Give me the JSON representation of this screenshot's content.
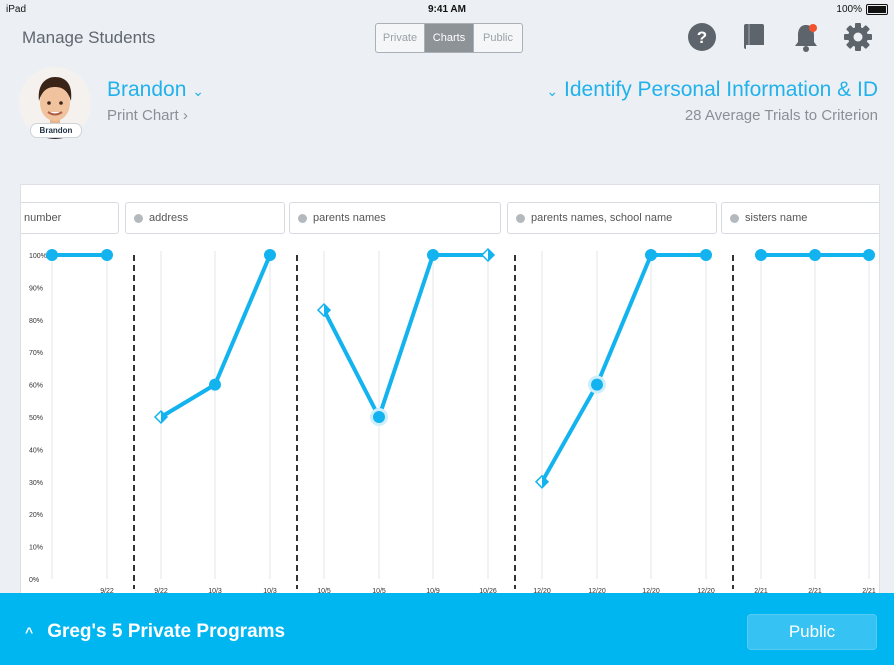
{
  "status_bar": {
    "device": "iPad",
    "time": "9:41 AM",
    "battery": "100%"
  },
  "header": {
    "title": "Manage Students",
    "segments": [
      {
        "label": "Private",
        "active": false
      },
      {
        "label": "Charts",
        "active": true
      },
      {
        "label": "Public",
        "active": false
      }
    ],
    "icons": [
      "help-icon",
      "book-icon",
      "bell-icon",
      "gear-icon"
    ]
  },
  "student": {
    "name": "Brandon",
    "avatar_label": "Brandon",
    "print_chart": "Print Chart ›"
  },
  "program": {
    "name": "Identify Personal Information & ID",
    "subtitle": "28 Average Trials to Criterion"
  },
  "chart_data": {
    "type": "line",
    "ylim": [
      0,
      100
    ],
    "y_ticks": [
      "0%",
      "10%",
      "20%",
      "30%",
      "40%",
      "50%",
      "60%",
      "70%",
      "80%",
      "90%",
      "100%"
    ],
    "accent_color": "#13b3ef",
    "phases": [
      {
        "label": "number",
        "dates": [
          "",
          "9/22"
        ],
        "values": [
          100,
          100
        ],
        "markers": [
          "dot",
          "dot"
        ]
      },
      {
        "label": "address",
        "dates": [
          "9/22",
          "10/3",
          "10/3"
        ],
        "values": [
          50,
          60,
          100
        ],
        "markers": [
          "half",
          "dot",
          "dot"
        ]
      },
      {
        "label": "parents names",
        "dates": [
          "10/5",
          "10/5",
          "10/9",
          "10/26"
        ],
        "values": [
          83,
          50,
          100,
          100
        ],
        "markers": [
          "half",
          "ring",
          "dot",
          "half"
        ]
      },
      {
        "label": "parents names, school name",
        "dates": [
          "12/20",
          "12/20",
          "12/20",
          "12/20"
        ],
        "values": [
          30,
          60,
          100,
          100
        ],
        "markers": [
          "half",
          "ring",
          "dot",
          "dot"
        ]
      },
      {
        "label": "sisters name",
        "dates": [
          "2/21",
          "2/21",
          "2/21"
        ],
        "values": [
          100,
          100,
          100
        ],
        "markers": [
          "dot",
          "dot",
          "dot"
        ]
      }
    ]
  },
  "footer": {
    "chevron": "^",
    "title": "Greg's 5 Private Programs",
    "public_button": "Public"
  }
}
